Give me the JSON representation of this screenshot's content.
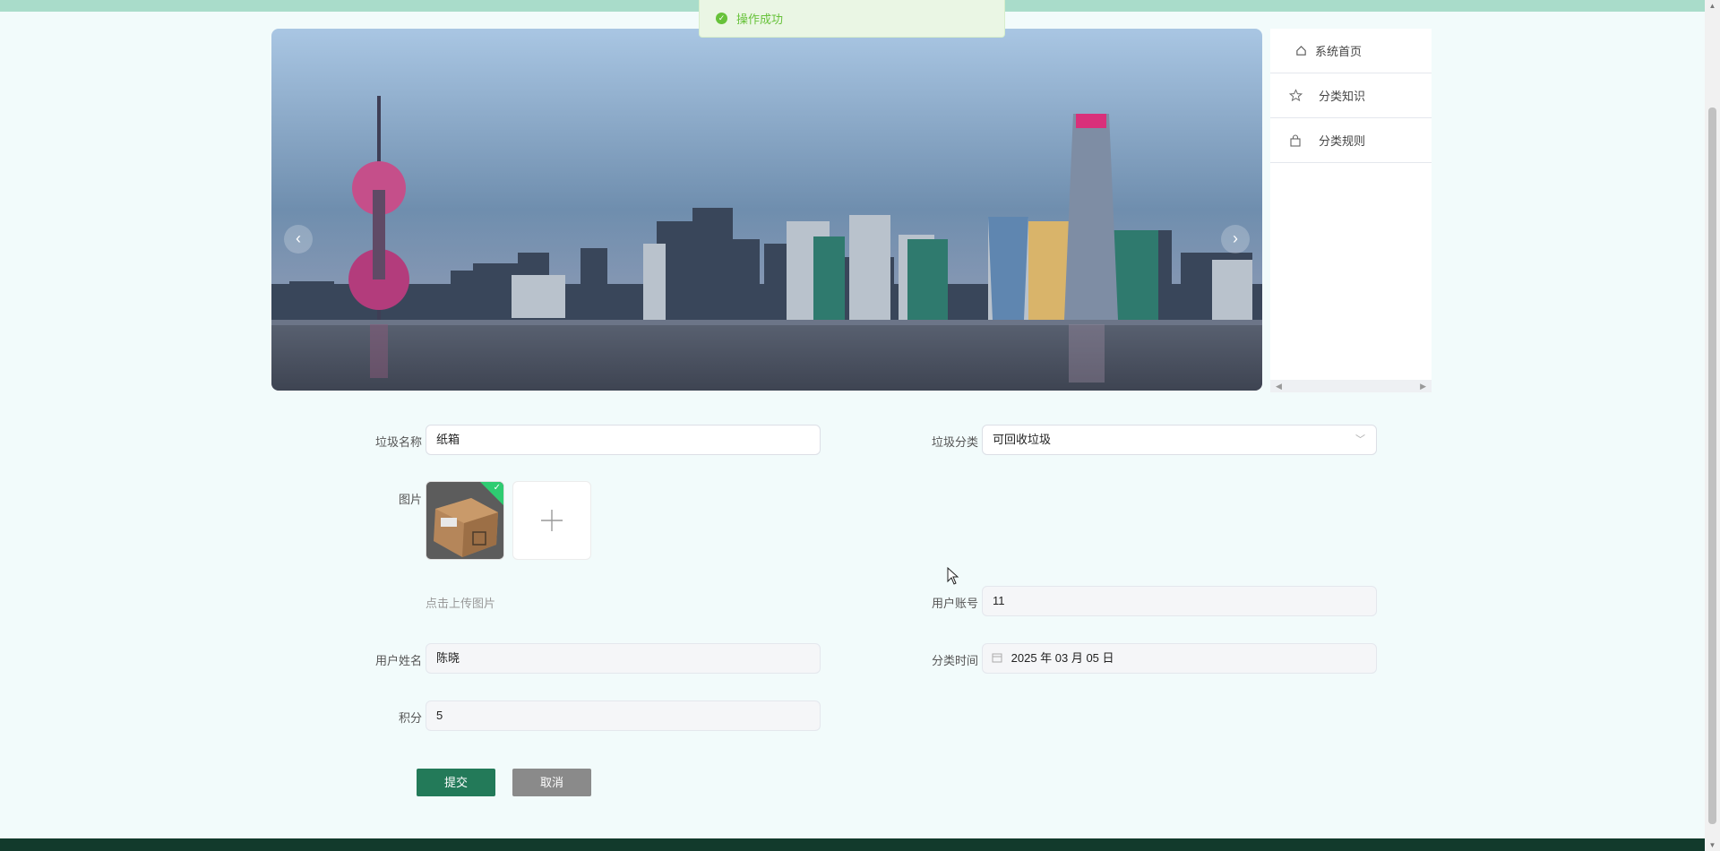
{
  "toast": {
    "message": "操作成功",
    "icon": "success-check-icon"
  },
  "carousel": {
    "prev_icon": "‹",
    "next_icon": "›",
    "slide_count": 3,
    "active_index": 0,
    "image": "city-skyline-photo"
  },
  "sidebar": {
    "items": [
      {
        "label": "系统首页",
        "icon": "home-icon"
      },
      {
        "label": "分类知识",
        "icon": "star-icon"
      },
      {
        "label": "分类规则",
        "icon": "bag-icon"
      }
    ]
  },
  "form": {
    "name_label": "垃圾名称",
    "name_value": "纸箱",
    "category_label": "垃圾分类",
    "category_value": "可回收垃圾",
    "image_label": "图片",
    "upload_hint": "点击上传图片",
    "account_label": "用户账号",
    "account_value": "11",
    "username_label": "用户姓名",
    "username_value": "陈晓",
    "time_label": "分类时间",
    "time_value": "2025 年 03 月 05 日",
    "points_label": "积分",
    "points_value": "5",
    "submit_label": "提交",
    "cancel_label": "取消"
  },
  "colors": {
    "primary": "#237a59",
    "success": "#67c23a",
    "header": "#a9dcca",
    "footer": "#123a2c"
  }
}
